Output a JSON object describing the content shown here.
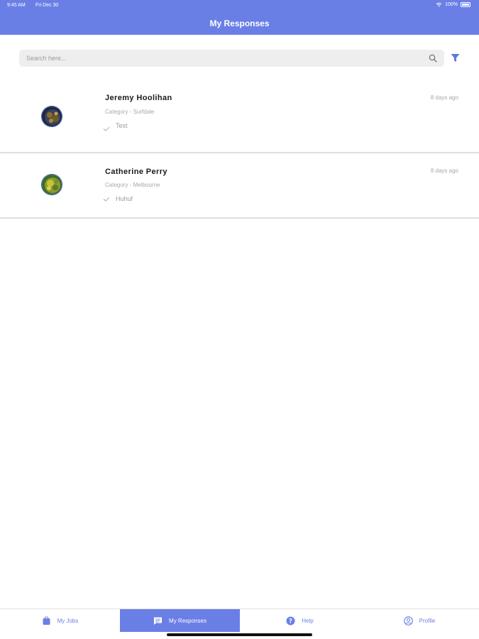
{
  "status_bar": {
    "time": "9:45 AM",
    "date": "Fri Dec 30",
    "battery": "100%"
  },
  "header": {
    "title": "My Responses"
  },
  "search": {
    "placeholder": "Search here...",
    "value": ""
  },
  "responses": [
    {
      "name": "Jeremy Hoolihan",
      "category": "Category - Surfdale",
      "message": "Test",
      "time_ago": "8 days ago"
    },
    {
      "name": "Catherine Perry",
      "category": "Category - Melbourne",
      "message": "Huhuf",
      "time_ago": "8 days ago"
    }
  ],
  "tabbar": {
    "tabs": [
      {
        "label": "My Jobs",
        "icon": "briefcase-icon"
      },
      {
        "label": "My Responses",
        "icon": "chat-icon",
        "active": true
      },
      {
        "label": "Help",
        "icon": "help-icon"
      },
      {
        "label": "Profile",
        "icon": "profile-icon"
      }
    ]
  },
  "colors": {
    "accent": "#6a7fe6",
    "header_text": "#ffffff",
    "secondary_text": "#a8a8a8"
  }
}
